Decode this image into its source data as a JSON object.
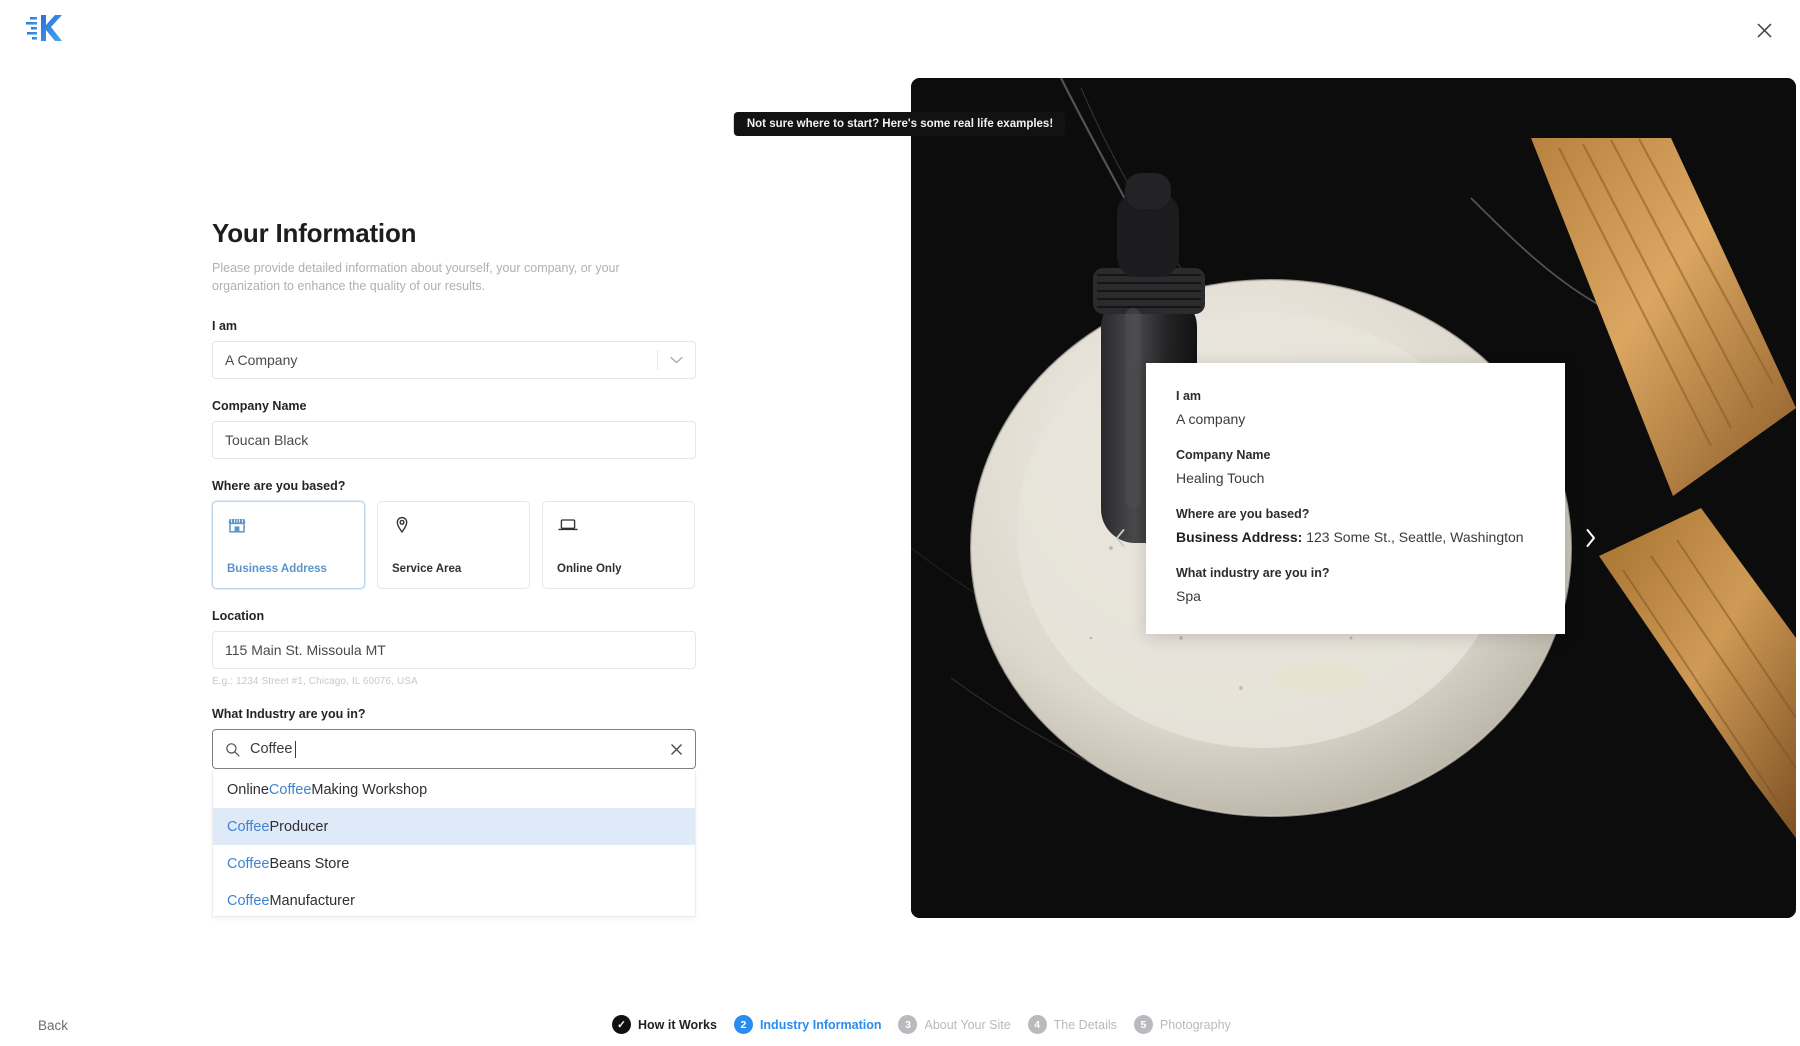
{
  "brand": {
    "logo_icon": "kustomer-logo-icon"
  },
  "topbar": {
    "close_icon": "close-icon"
  },
  "form": {
    "title": "Your Information",
    "subtitle": "Please provide detailed information about yourself, your company, or your organization to enhance the quality of our results.",
    "i_am": {
      "label": "I am",
      "value": "A Company",
      "icon": "chevron-down-icon"
    },
    "company_name": {
      "label": "Company Name",
      "value": "Toucan Black"
    },
    "based": {
      "label": "Where are you based?",
      "options": [
        {
          "label": "Business Address",
          "icon": "storefront-icon",
          "selected": true
        },
        {
          "label": "Service Area",
          "icon": "map-pin-icon",
          "selected": false
        },
        {
          "label": "Online Only",
          "icon": "laptop-icon",
          "selected": false
        }
      ]
    },
    "location": {
      "label": "Location",
      "value": "115 Main St. Missoula MT",
      "hint": "E.g.: 1234 Street #1, Chicago, IL 60076, USA"
    },
    "industry": {
      "label": "What Industry are you in?",
      "value": "Coffee",
      "search_icon": "search-icon",
      "clear_icon": "clear-x-icon",
      "suggestions": [
        {
          "prefix": "Online ",
          "match": "Coffee",
          "suffix": " Making Workshop",
          "hovered": false
        },
        {
          "prefix": "",
          "match": "Coffee",
          "suffix": " Producer",
          "hovered": true
        },
        {
          "prefix": "",
          "match": "Coffee",
          "suffix": " Beans Store",
          "hovered": false
        },
        {
          "prefix": "",
          "match": "Coffee",
          "suffix": " Manufacturer",
          "hovered": false
        }
      ]
    }
  },
  "preview": {
    "tip": "Not sure where to start? Here's some real life examples!",
    "prev_icon": "chevron-left-icon",
    "next_icon": "chevron-right-icon",
    "example": {
      "q1": "I am",
      "a1": "A company",
      "q2": "Company Name",
      "a2": "Healing Touch",
      "q3": "Where are you based?",
      "a3_label": "Business Address:",
      "a3_value": " 123 Some St., Seattle, Washington",
      "q4": "What industry are you in?",
      "a4": "Spa"
    }
  },
  "footer": {
    "back": "Back",
    "steps": [
      {
        "num": "✓",
        "label": "How it Works",
        "state": "done"
      },
      {
        "num": "2",
        "label": "Industry Information",
        "state": "active"
      },
      {
        "num": "3",
        "label": "About Your Site",
        "state": "todo"
      },
      {
        "num": "4",
        "label": "The Details",
        "state": "todo"
      },
      {
        "num": "5",
        "label": "Photography",
        "state": "todo"
      }
    ]
  },
  "colors": {
    "accent_blue": "#2a8cf0",
    "selected_blue": "#5b93cd",
    "highlight_blue": "#3e84d4",
    "hover_row": "#dfeaf8"
  }
}
